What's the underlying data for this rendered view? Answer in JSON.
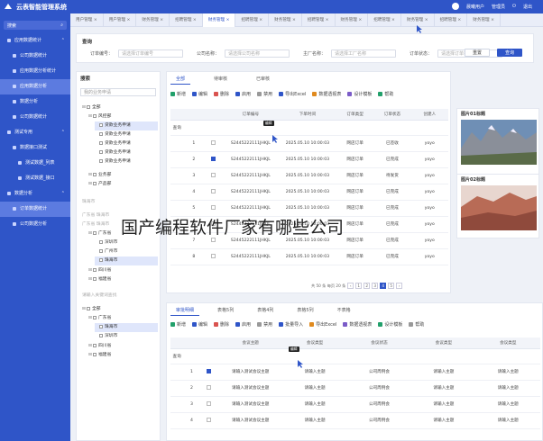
{
  "app": {
    "title": "云表智能管理系统",
    "user_name": "晨曦用户",
    "user_role": "管理员",
    "exit_label": "退出"
  },
  "nav_tabs": [
    "用户管理",
    "用户管理",
    "财务管理",
    "招聘管理",
    "财务管理",
    "招聘管理",
    "财务管理",
    "招聘管理",
    "财务管理",
    "招聘管理",
    "财务管理",
    "招聘管理",
    "财务管理"
  ],
  "nav_active_index": 4,
  "sidebar": {
    "search_label": "搜索",
    "items": [
      {
        "label": "应用数据统计",
        "level": 0,
        "active": false
      },
      {
        "label": "公司数据统计",
        "level": 1,
        "active": false
      },
      {
        "label": "应用数据分析统计",
        "level": 1,
        "active": false
      },
      {
        "label": "应用数据分析",
        "level": 1,
        "active": true
      },
      {
        "label": "数据分析",
        "level": 1,
        "active": false
      },
      {
        "label": "公司数据统计",
        "level": 1,
        "active": false
      },
      {
        "label": "测试专用",
        "level": 0,
        "active": false
      },
      {
        "label": "数据接口测试",
        "level": 1,
        "active": false
      },
      {
        "label": "测试数据_列表",
        "level": 2,
        "active": false
      },
      {
        "label": "测试数据_接口",
        "level": 2,
        "active": false
      },
      {
        "label": "数据分析",
        "level": 0,
        "active": false
      },
      {
        "label": "订单数据统计",
        "level": 1,
        "active": true
      },
      {
        "label": "公司数据分析",
        "level": 1,
        "active": false
      }
    ]
  },
  "query": {
    "title": "查询",
    "fields": [
      {
        "label": "订单编号：",
        "placeholder": "请选择订单编号"
      },
      {
        "label": "公司名称：",
        "placeholder": "请选择公司名称"
      },
      {
        "label": "主厂名称：",
        "placeholder": "请选择工厂名称"
      },
      {
        "label": "订单状态：",
        "placeholder": "请选择订单状态"
      }
    ],
    "reset_label": "重置",
    "search_label": "查询"
  },
  "tree": {
    "title": "搜索",
    "search_placeholder": "我的业务申请",
    "nodes": [
      {
        "label": "全部",
        "indent": 0
      },
      {
        "label": "风控部",
        "indent": 1
      },
      {
        "label": "贷款业务申请",
        "indent": 2,
        "selected": true
      },
      {
        "label": "贷款业务申请",
        "indent": 2
      },
      {
        "label": "贷款业务申请",
        "indent": 2
      },
      {
        "label": "贷款业务申请",
        "indent": 2
      },
      {
        "label": "贷款业务申请",
        "indent": 2
      },
      {
        "label": "业务部",
        "indent": 1
      },
      {
        "label": "产品部",
        "indent": 1
      },
      {
        "label": "珠海市",
        "indent": 0
      },
      {
        "label": "广东省 珠海市",
        "indent": 0
      },
      {
        "label": "广东省 珠海市",
        "indent": 0
      },
      {
        "label": "广东省",
        "indent": 1
      },
      {
        "label": "深圳市",
        "indent": 2
      },
      {
        "label": "广州市",
        "indent": 2
      },
      {
        "label": "珠海市",
        "indent": 2,
        "selected": true
      },
      {
        "label": "四川省",
        "indent": 1
      },
      {
        "label": "福建省",
        "indent": 1
      },
      {
        "label": "请输入关键词查找",
        "indent": 0
      },
      {
        "label": "全部",
        "indent": 0
      },
      {
        "label": "广东省",
        "indent": 1
      },
      {
        "label": "珠海市",
        "indent": 2,
        "selected": true
      },
      {
        "label": "深圳市",
        "indent": 2
      },
      {
        "label": "四川省",
        "indent": 1
      },
      {
        "label": "福建省",
        "indent": 1
      }
    ]
  },
  "main": {
    "tabs": [
      "全部",
      "待审核",
      "已审核"
    ],
    "toolbar": [
      "新增",
      "编辑",
      "删除",
      "启用",
      "禁用",
      "导出Excel",
      "数据透视表",
      "设计模板",
      "帮助"
    ],
    "columns": [
      "",
      "",
      "",
      "订单编号",
      "下单时间",
      "订单类型",
      "订单状态",
      "创建人"
    ],
    "filter_label": "查询",
    "rows": [
      {
        "no": "1",
        "checked": false,
        "order": "S2445222111JHKJL",
        "time": "2025.05.10 10:00:03",
        "type": "网店订单",
        "status": "已签收",
        "creator": "yoyo",
        "status_type": "pend"
      },
      {
        "no": "2",
        "checked": true,
        "order": "S2445222111JHKJL",
        "time": "2025.05.10 10:00:03",
        "type": "网店订单",
        "status": "已完成",
        "creator": "yoyo",
        "status_type": "ok"
      },
      {
        "no": "3",
        "checked": false,
        "order": "S2445222111JHKJL",
        "time": "2025.05.10 10:00:03",
        "type": "网店订单",
        "status": "待发货",
        "creator": "yoyo",
        "status_type": "pend"
      },
      {
        "no": "4",
        "checked": false,
        "order": "S2445222111JHKJL",
        "time": "2025.05.10 10:00:03",
        "type": "网店订单",
        "status": "已完成",
        "creator": "yoyo",
        "status_type": "ok"
      },
      {
        "no": "5",
        "checked": false,
        "order": "S2445222111JHKJL",
        "time": "2025.05.10 10:00:03",
        "type": "网店订单",
        "status": "已完成",
        "creator": "yoyo",
        "status_type": "ok"
      },
      {
        "no": "6",
        "checked": false,
        "order": "S2445222111JHKJL",
        "time": "2025.05.10 10:00:03",
        "type": "网店订单",
        "status": "已完成",
        "creator": "yoyo",
        "status_type": "ok"
      },
      {
        "no": "7",
        "checked": false,
        "order": "S2445222111JHKJL",
        "time": "2025.05.10 10:00:03",
        "type": "网店订单",
        "status": "已完成",
        "creator": "yoyo",
        "status_type": "ok"
      },
      {
        "no": "8",
        "checked": false,
        "order": "S2445222111JHKJL",
        "time": "2025.05.10 10:00:03",
        "type": "网店订单",
        "status": "已完成",
        "creator": "yoyo",
        "status_type": "ok"
      }
    ],
    "pager_text": "共 50 条  每页 20 条",
    "pages": [
      "1",
      "2",
      "3",
      "4",
      "5"
    ],
    "page_active": 3
  },
  "right": {
    "card1_title": "图片01标题",
    "card2_title": "图片02标题"
  },
  "detail": {
    "tabs": [
      "审批明细",
      "表格5列",
      "表格4列",
      "表格5列",
      "不表格"
    ],
    "toolbar": [
      "新增",
      "编辑",
      "删除",
      "启用",
      "禁用",
      "批量导入",
      "导出Excel",
      "数据透视表",
      "设计模板",
      "帮助"
    ],
    "columns": [
      "",
      "",
      "",
      "会议主题",
      "会议类型",
      "会议状态",
      "会议类型",
      "会议类型"
    ],
    "filter_label": "查询",
    "rows": [
      {
        "no": "1",
        "checked": true,
        "topic": "请输入测试会议主题",
        "type": "请输入主题",
        "state": "公司周例会",
        "t2": "请输入主题",
        "t3": "请输入主题"
      },
      {
        "no": "2",
        "checked": false,
        "topic": "请输入测试会议主题",
        "type": "请输入主题",
        "state": "公司周例会",
        "t2": "请输入主题",
        "t3": "请输入主题"
      },
      {
        "no": "3",
        "checked": false,
        "topic": "请输入测试会议主题",
        "type": "请输入主题",
        "state": "公司周例会",
        "t2": "请输入主题",
        "t3": "请输入主题"
      },
      {
        "no": "4",
        "checked": false,
        "topic": "请输入测试会议主题",
        "type": "请输入主题",
        "state": "公司周例会",
        "t2": "请输入主题",
        "t3": "请输入主题"
      }
    ]
  },
  "overlay": {
    "text": "国产编程软件厂家有哪些公司",
    "tooltip": "编辑"
  },
  "colors": {
    "primary": "#2f55c8",
    "ok": "#22a06b",
    "pending": "#e08a1e"
  }
}
